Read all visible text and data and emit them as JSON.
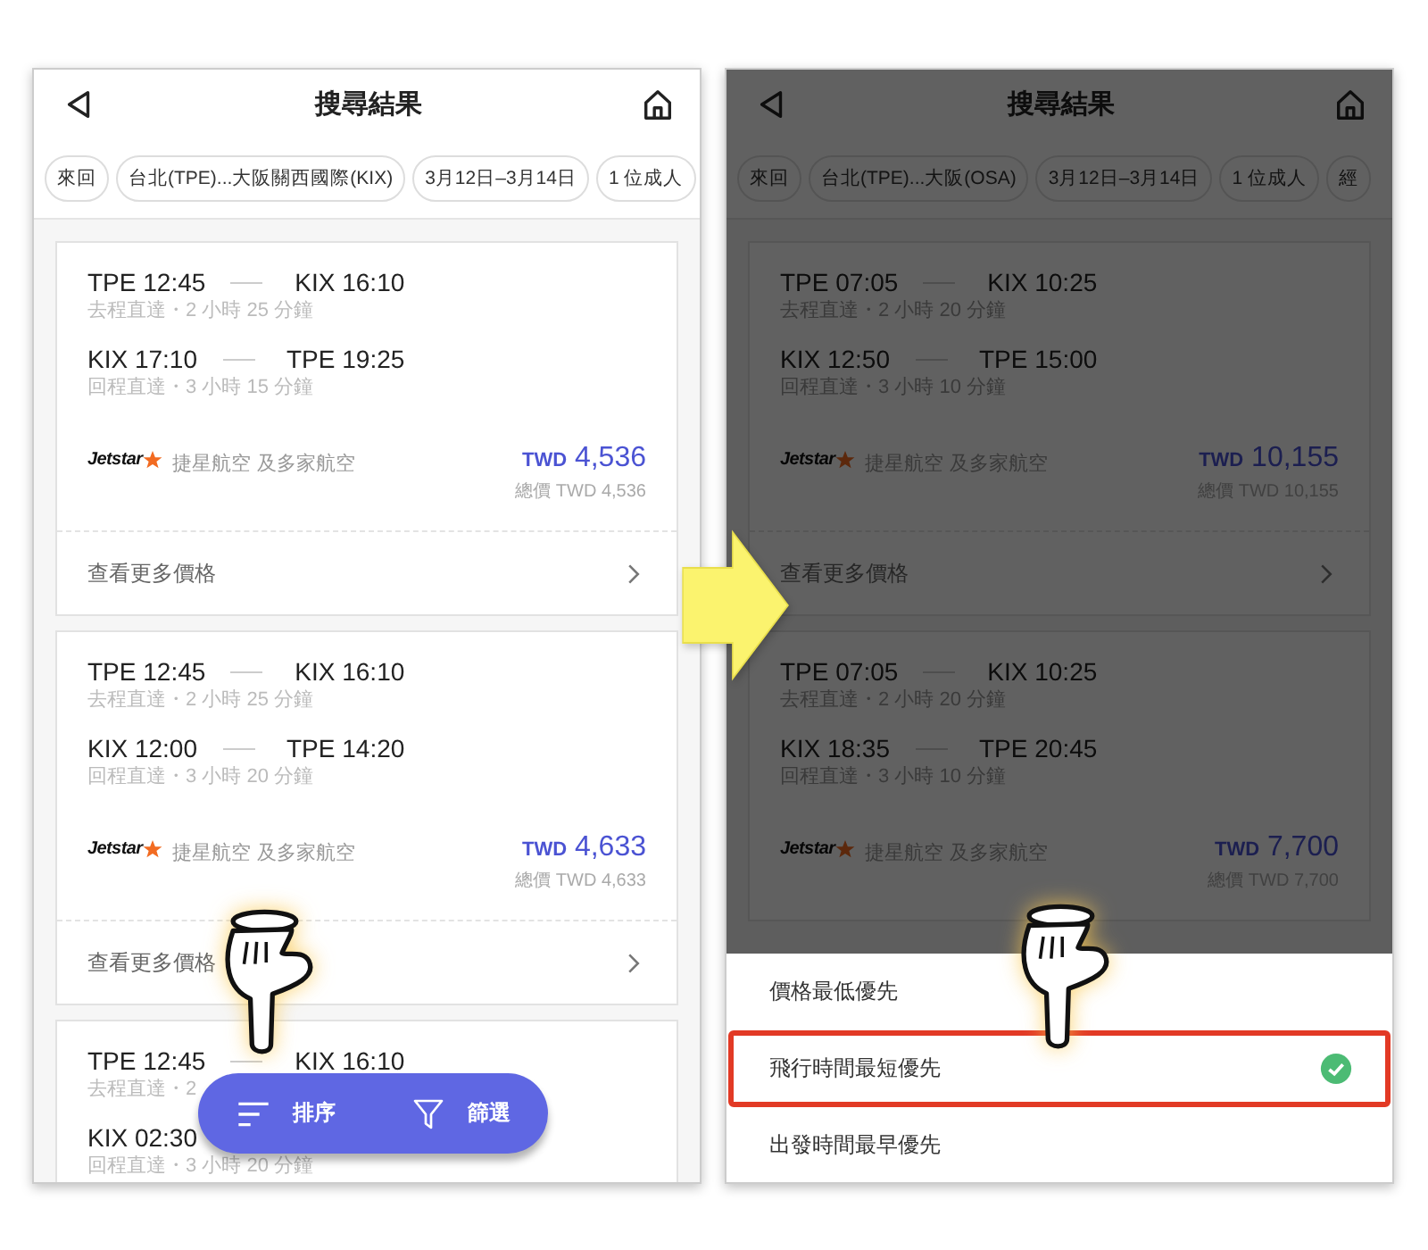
{
  "screens": [
    {
      "title": "搜尋結果",
      "dimmed": false,
      "chips": [
        "來回",
        "台北(TPE)...大阪關西國際(KIX)",
        "3月12日–3月14日",
        "1 位成人"
      ],
      "results": [
        {
          "legs": [
            {
              "from": "TPE 12:45",
              "to": "KIX 16:10",
              "info": "去程直達・2 小時 25 分鐘"
            },
            {
              "from": "KIX 17:10",
              "to": "TPE 19:25",
              "info": "回程直達・3 小時 15 分鐘"
            }
          ],
          "logo": "Jetstar",
          "airline": "捷星航空 及多家航空",
          "currency": "TWD",
          "price": "4,536",
          "total": "總價 TWD 4,536",
          "more": "查看更多價格"
        },
        {
          "legs": [
            {
              "from": "TPE 12:45",
              "to": "KIX 16:10",
              "info": "去程直達・2 小時 25 分鐘"
            },
            {
              "from": "KIX 12:00",
              "to": "TPE 14:20",
              "info": "回程直達・3 小時 20 分鐘"
            }
          ],
          "logo": "Jetstar",
          "airline": "捷星航空 及多家航空",
          "currency": "TWD",
          "price": "4,633",
          "total": "總價 TWD 4,633",
          "more": "查看更多價格"
        },
        {
          "legs": [
            {
              "from": "TPE 12:45",
              "to": "KIX 16:10",
              "info": "去程直達・2"
            },
            {
              "from": "KIX 02:30",
              "info": "回程直達・3 小時 20 分鐘"
            }
          ]
        }
      ],
      "action_bar": {
        "sort": "排序",
        "filter": "篩選"
      }
    },
    {
      "title": "搜尋結果",
      "dimmed": true,
      "chips": [
        "來回",
        "台北(TPE)...大阪(OSA)",
        "3月12日–3月14日",
        "1 位成人",
        "經"
      ],
      "results": [
        {
          "legs": [
            {
              "from": "TPE 07:05",
              "to": "KIX 10:25",
              "info": "去程直達・2 小時 20 分鐘"
            },
            {
              "from": "KIX 12:50",
              "to": "TPE 15:00",
              "info": "回程直達・3 小時 10 分鐘"
            }
          ],
          "logo": "Jetstar",
          "airline": "捷星航空 及多家航空",
          "currency": "TWD",
          "price": "10,155",
          "total": "總價 TWD 10,155",
          "more": "查看更多價格"
        },
        {
          "legs": [
            {
              "from": "TPE 07:05",
              "to": "KIX 10:25",
              "info": "去程直達・2 小時 20 分鐘"
            },
            {
              "from": "KIX 18:35",
              "to": "TPE 20:45",
              "info": "回程直達・3 小時 10 分鐘"
            }
          ],
          "logo": "Jetstar",
          "airline": "捷星航空 及多家航空",
          "currency": "TWD",
          "price": "7,700",
          "total": "總價 TWD 7,700"
        }
      ],
      "sort_sheet": {
        "options": [
          {
            "label": "價格最低優先",
            "selected": false
          },
          {
            "label": "飛行時間最短優先",
            "selected": true
          },
          {
            "label": "出發時間最早優先",
            "selected": false
          }
        ]
      }
    }
  ]
}
